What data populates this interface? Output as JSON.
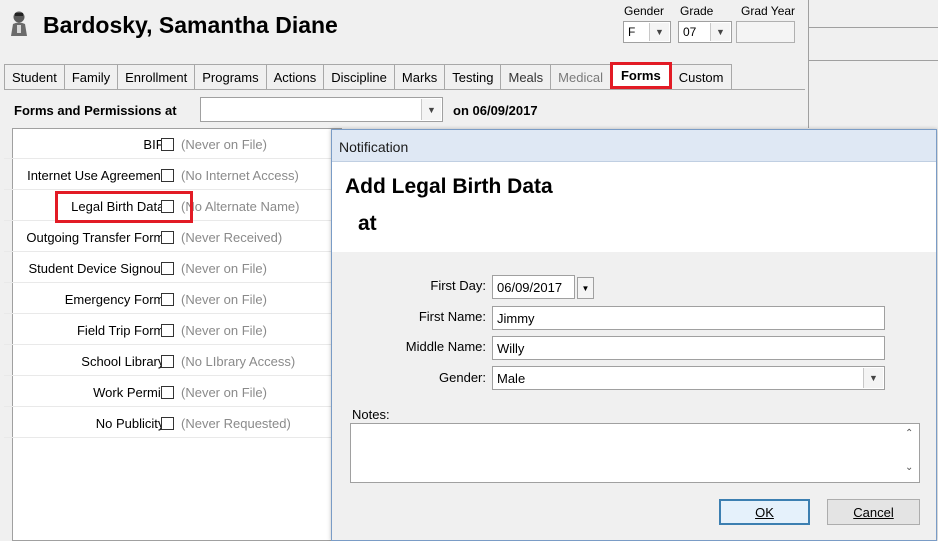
{
  "student": {
    "name": "Bardosky, Samantha Diane"
  },
  "header_fields": {
    "gender_label": "Gender",
    "gender_value": "F",
    "grade_label": "Grade",
    "grade_value": "07",
    "grad_year_label": "Grad Year",
    "grad_year_value": ""
  },
  "tabs": [
    {
      "label": "Student"
    },
    {
      "label": "Family"
    },
    {
      "label": "Enrollment"
    },
    {
      "label": "Programs"
    },
    {
      "label": "Actions"
    },
    {
      "label": "Discipline"
    },
    {
      "label": "Marks"
    },
    {
      "label": "Testing"
    },
    {
      "label": "Meals"
    },
    {
      "label": "Medical"
    },
    {
      "label": "Forms"
    },
    {
      "label": "Custom"
    }
  ],
  "active_tab": "Forms",
  "forms_header": {
    "label": "Forms and Permissions at",
    "select_value": "",
    "date_text": "on 06/09/2017"
  },
  "forms": [
    {
      "label": "BIP:",
      "status": "(Never on File)",
      "checked": false
    },
    {
      "label": "Internet Use Agreement:",
      "status": "(No Internet Access)",
      "checked": false
    },
    {
      "label": "Legal Birth Data:",
      "status": "(No Alternate Name)",
      "checked": false
    },
    {
      "label": "Outgoing Transfer Form:",
      "status": "(Never Received)",
      "checked": false
    },
    {
      "label": "Student Device Signout:",
      "status": "(Never on File)",
      "checked": false
    },
    {
      "label": "Emergency Form:",
      "status": "(Never on File)",
      "checked": false
    },
    {
      "label": "Field Trip Form:",
      "status": "(Never on File)",
      "checked": false
    },
    {
      "label": "School Library:",
      "status": "(No LIbrary Access)",
      "checked": false
    },
    {
      "label": "Work Permit:",
      "status": "(Never on File)",
      "checked": false
    },
    {
      "label": "No Publicity:",
      "status": "(Never Requested)",
      "checked": false
    }
  ],
  "dialog": {
    "title": "Notification",
    "heading": "Add Legal Birth Data",
    "subheading": "at",
    "first_day_label": "First Day:",
    "first_day_value": "06/09/2017",
    "first_name_label": "First Name:",
    "first_name_value": "Jimmy",
    "middle_name_label": "Middle Name:",
    "middle_name_value": "Willy",
    "gender_label": "Gender:",
    "gender_value": "Male",
    "notes_label": "Notes:",
    "notes_value": "",
    "ok_label": "OK",
    "cancel_label": "Cancel"
  },
  "colors": {
    "highlight": "#e21b25",
    "dialog_title_bg": "#dfe8f4",
    "primary_button_border": "#3c7fb1"
  }
}
